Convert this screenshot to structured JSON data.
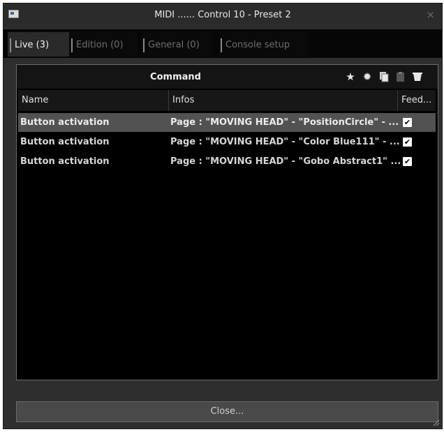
{
  "window": {
    "title": "MIDI ...... Control 10 - Preset 2",
    "close_glyph": "×"
  },
  "tabs": [
    {
      "label": "Live (3)",
      "active": true
    },
    {
      "label": "Edition (0)",
      "active": false
    },
    {
      "label": "General (0)",
      "active": false
    },
    {
      "label": "Console setup",
      "active": false
    }
  ],
  "command_panel": {
    "title": "Command",
    "toolbar_icons": [
      "star-icon",
      "gear-icon",
      "copy-icon",
      "paste-icon",
      "delete-icon"
    ]
  },
  "table": {
    "columns": [
      "Name",
      "Infos",
      "Feed..."
    ],
    "rows": [
      {
        "name": "Button activation",
        "info": "Page : \"MOVING HEAD\" - \"PositionCircle\" - ...",
        "feedback": true,
        "selected": true
      },
      {
        "name": "Button activation",
        "info": "Page : \"MOVING HEAD\" - \"Color Blue111\" - ...",
        "feedback": true,
        "selected": false
      },
      {
        "name": "Button activation",
        "info": "Page : \"MOVING HEAD\" - \"Gobo Abstract1\" ...",
        "feedback": true,
        "selected": false
      }
    ]
  },
  "footer": {
    "close_label": "Close..."
  },
  "colors": {
    "window_bg": "#2e2e2e",
    "panel_bg": "#000000",
    "selected_row": "#525252",
    "active_tab": "#2a2a2a"
  }
}
